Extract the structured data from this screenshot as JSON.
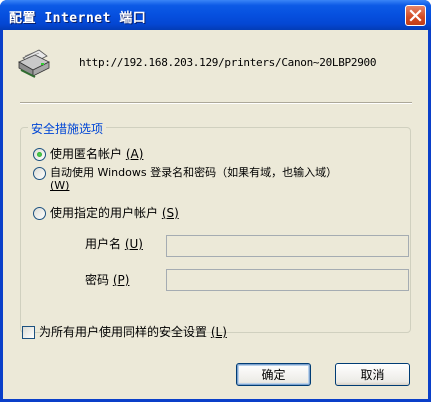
{
  "window": {
    "title": "配置 Internet 端口"
  },
  "header": {
    "url": "http://192.168.203.129/printers/Canon~20LBP2900",
    "icon": "printer-icon"
  },
  "security_group": {
    "legend": "安全措施选项",
    "options": [
      {
        "text": "使用匿名帐户 ",
        "key": "(A)",
        "selected": true
      },
      {
        "text": "自动使用 Windows 登录名和密码（如果有域，也输入域）",
        "key": "(W)",
        "selected": false
      },
      {
        "text": "使用指定的用户帐户 ",
        "key": "(S)",
        "selected": false
      }
    ],
    "username": {
      "label": "用户名 ",
      "key": "(U)",
      "value": ""
    },
    "password": {
      "label": "密码 ",
      "key": "(P)",
      "value": ""
    }
  },
  "apply_all": {
    "text": "为所有用户使用同样的安全设置 ",
    "key": "(L)",
    "checked": false
  },
  "buttons": {
    "ok": "确定",
    "cancel": "取消"
  },
  "colors": {
    "titlebar": "#0650df",
    "dialog_bg": "#ece9d8",
    "group_legend": "#0046d5",
    "close_button": "#d24a22"
  }
}
